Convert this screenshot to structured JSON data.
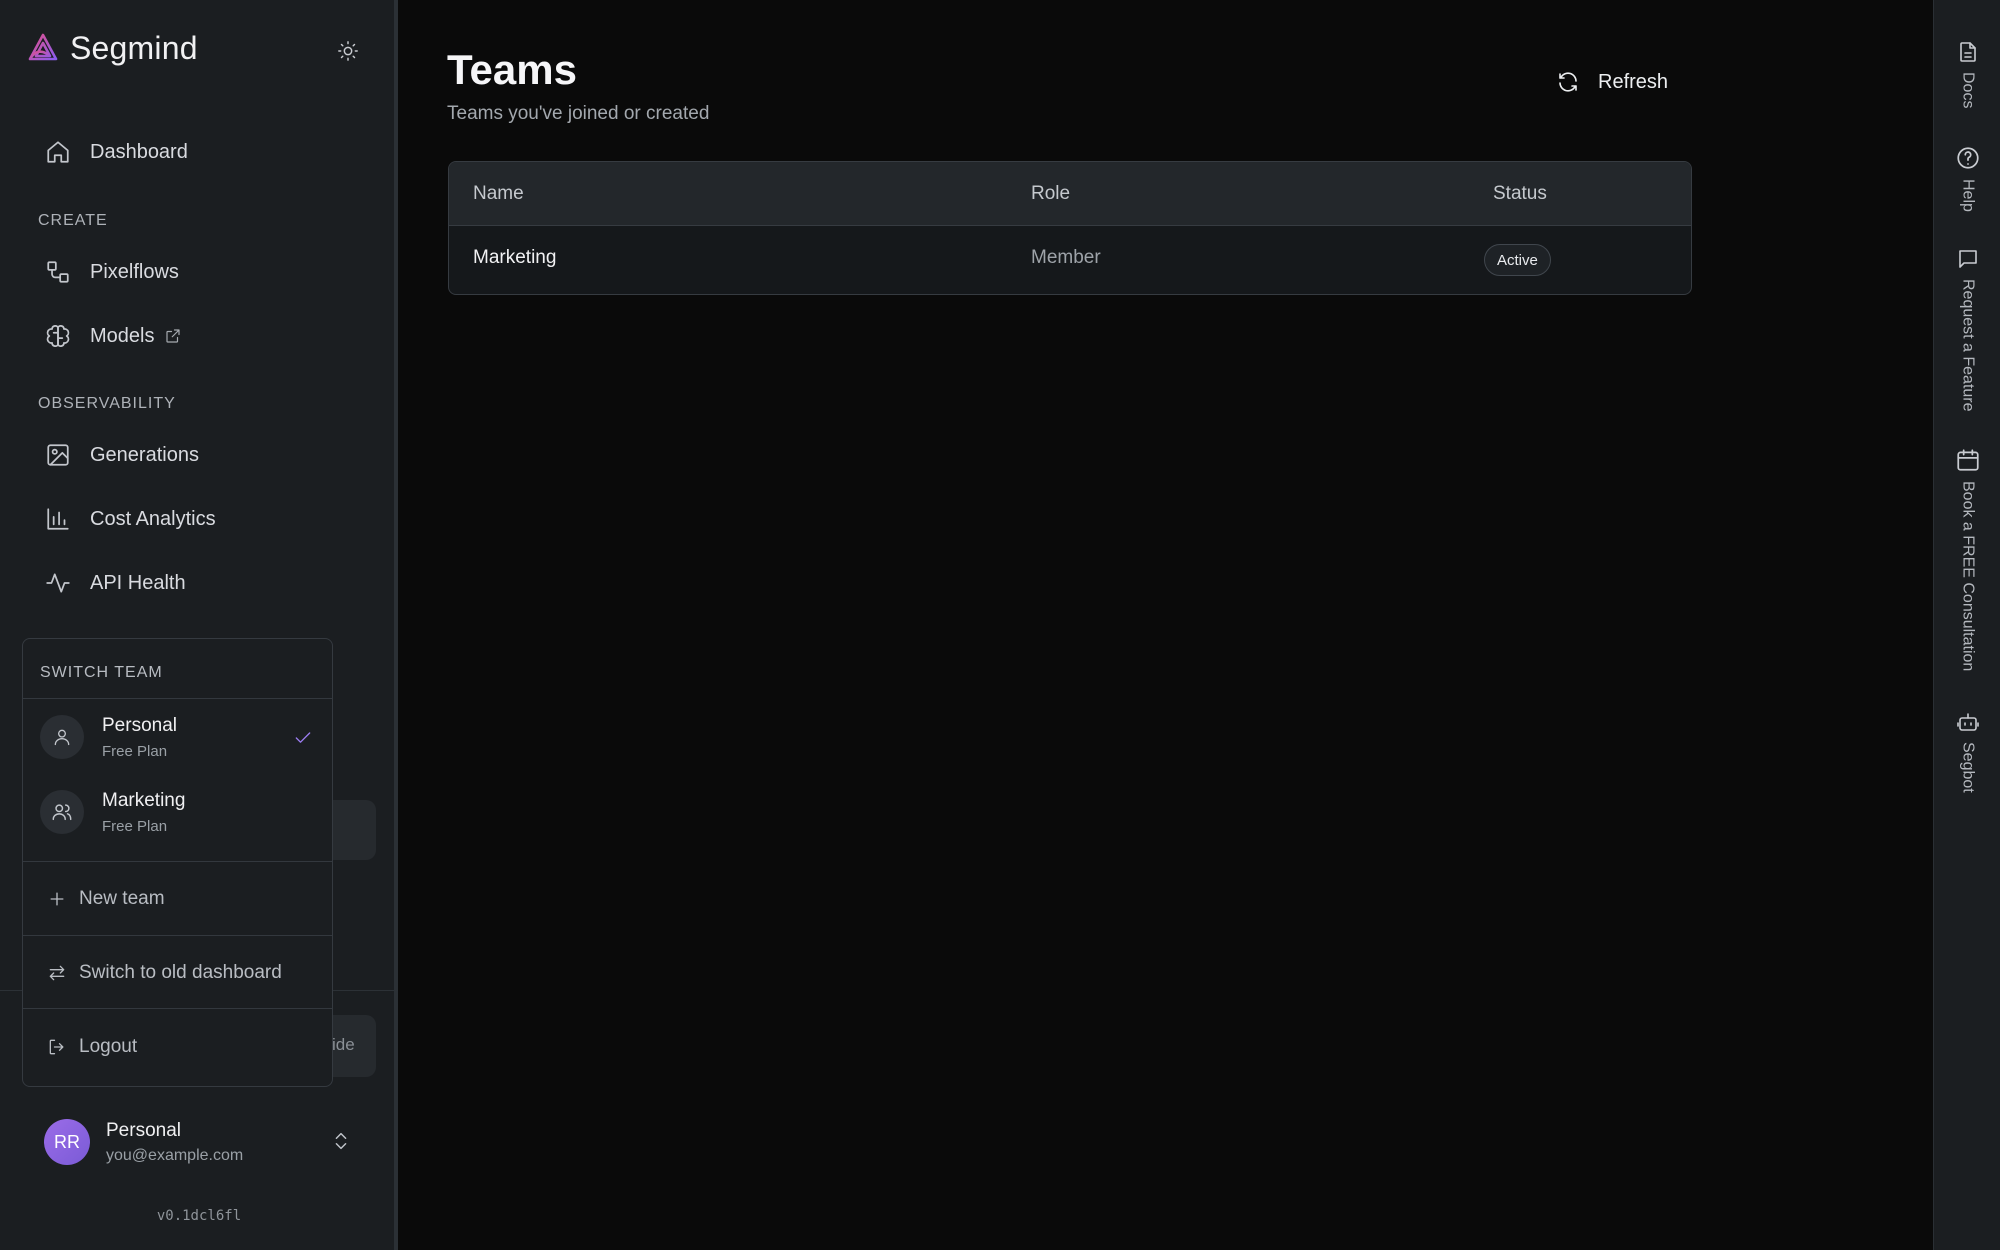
{
  "brand": {
    "name": "Segmind",
    "accent": "#9b6ce8"
  },
  "sidebar": {
    "dashboard": "Dashboard",
    "section_create": "CREATE",
    "pixelflows": "Pixelflows",
    "models": "Models",
    "section_observability": "OBSERVABILITY",
    "generations": "Generations",
    "cost_analytics": "Cost Analytics",
    "api_health": "API Health",
    "hidden_button_fragment": "ide"
  },
  "switcher": {
    "heading": "SWITCH TEAM",
    "teams": [
      {
        "name": "Personal",
        "plan": "Free Plan",
        "selected": true,
        "icon": "user-icon"
      },
      {
        "name": "Marketing",
        "plan": "Free Plan",
        "selected": false,
        "icon": "users-icon"
      }
    ],
    "new_team": "New team",
    "old_dashboard": "Switch to old dashboard",
    "logout": "Logout"
  },
  "account": {
    "initials": "RR",
    "name": "Personal",
    "email": "you@example.com"
  },
  "version": "v0.1dcl6fl",
  "main": {
    "title": "Teams",
    "subtitle": "Teams you've joined or created",
    "refresh": "Refresh",
    "table": {
      "headers": [
        "Name",
        "Role",
        "Status"
      ],
      "rows": [
        {
          "name": "Marketing",
          "role": "Member",
          "status": "Active"
        }
      ]
    }
  },
  "rail": {
    "docs": "Docs",
    "help": "Help",
    "feature": "Request a Feature",
    "consult": "Book a FREE Consultation",
    "segbot": "Segbot"
  }
}
